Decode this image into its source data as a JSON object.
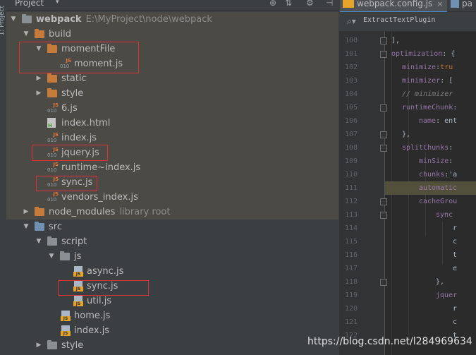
{
  "strip": {
    "label": "1: Project"
  },
  "header": {
    "title": "Project",
    "icons": [
      "globe-icon",
      "split-icon",
      "gear-icon",
      "collapse-icon"
    ]
  },
  "tree": [
    {
      "type": "root",
      "name": "webpack",
      "path": "E:\\MyProject\\node\\webpack"
    },
    {
      "type": "folder",
      "name": "build"
    },
    {
      "type": "folder",
      "name": "momentFile"
    },
    {
      "type": "jsfile",
      "name": "moment.js"
    },
    {
      "type": "folder",
      "name": "static"
    },
    {
      "type": "folder",
      "name": "style"
    },
    {
      "type": "jsfile",
      "name": "6.js"
    },
    {
      "type": "html",
      "name": "index.html"
    },
    {
      "type": "jsfile",
      "name": "index.js"
    },
    {
      "type": "jsfile",
      "name": "jquery.js"
    },
    {
      "type": "jsfile",
      "name": "runtime~index.js"
    },
    {
      "type": "jsfile",
      "name": "sync.js"
    },
    {
      "type": "jsfile",
      "name": "vendors_index.js"
    },
    {
      "type": "folder",
      "name": "node_modules",
      "extra": "library root"
    },
    {
      "type": "folder",
      "name": "src"
    },
    {
      "type": "folder",
      "name": "script"
    },
    {
      "type": "folder",
      "name": "js"
    },
    {
      "type": "js",
      "name": "async.js"
    },
    {
      "type": "js",
      "name": "sync.js"
    },
    {
      "type": "js",
      "name": "util.js"
    },
    {
      "type": "js",
      "name": "home.js"
    },
    {
      "type": "js",
      "name": "index.js"
    },
    {
      "type": "folder",
      "name": "style"
    }
  ],
  "editor": {
    "tabs": [
      {
        "label": "webpack.config.js"
      },
      {
        "label": "pa"
      }
    ],
    "search": "ExtractTextPlugin",
    "line_numbers": [
      "100",
      "101",
      "102",
      "103",
      "104",
      "105",
      "106",
      "107",
      "108",
      "109",
      "110",
      "111",
      "112",
      "113",
      "114",
      "115",
      "116",
      "117",
      "118",
      "119",
      "120",
      "121",
      "122"
    ],
    "lines": [
      [
        [
          "p",
          "],"
        ]
      ],
      [
        [
          "k",
          "optimization"
        ],
        [
          "p",
          ": {"
        ]
      ],
      [
        [
          "k",
          "minimize"
        ],
        [
          "p",
          ":"
        ],
        [
          "o",
          "tru"
        ]
      ],
      [
        [
          "k",
          "minimizer"
        ],
        [
          "p",
          ": ["
        ]
      ],
      [
        [
          "c",
          "// minimizer"
        ]
      ],
      [
        [
          "k",
          "runtimeChunk"
        ],
        [
          "p",
          ":"
        ]
      ],
      [
        [
          "k",
          "name"
        ],
        [
          "p",
          ": ent"
        ]
      ],
      [
        [
          "p",
          "},"
        ]
      ],
      [
        [
          "k",
          "splitChunks"
        ],
        [
          "p",
          ":"
        ]
      ],
      [
        [
          "k",
          "minSize"
        ],
        [
          "p",
          ":"
        ]
      ],
      [
        [
          "k",
          "chunks"
        ],
        [
          "p",
          ":'a"
        ]
      ],
      [
        [
          "k",
          "automatic"
        ]
      ],
      [
        [
          "k",
          "cacheGrou"
        ]
      ],
      [
        [
          "k",
          "sync"
        ]
      ],
      [
        [
          "p",
          "r"
        ]
      ],
      [
        [
          "p",
          "c"
        ]
      ],
      [
        [
          "p",
          "t"
        ]
      ],
      [
        [
          "p",
          "e"
        ]
      ],
      [
        [
          "p",
          "},"
        ]
      ],
      [
        [
          "k",
          "jquer"
        ]
      ],
      [
        [
          "p",
          "r"
        ]
      ],
      [
        [
          "p",
          "c"
        ]
      ],
      [
        [
          "p",
          "t"
        ]
      ]
    ]
  },
  "watermark": "https://blog.csdn.net/l284969634"
}
